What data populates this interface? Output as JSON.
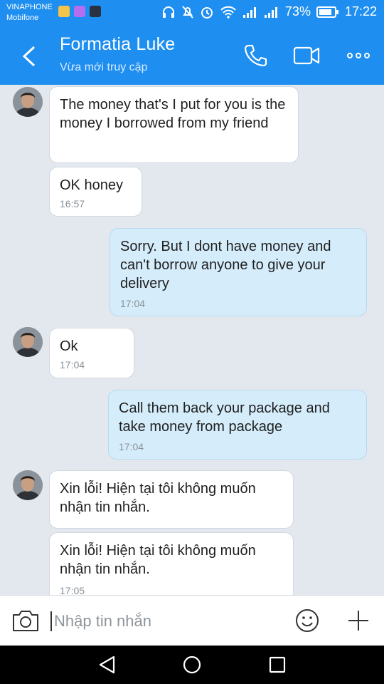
{
  "status_bar": {
    "carrier_1": "VINAPHONE",
    "carrier_2": "Mobifone",
    "battery_percent": "73%",
    "time": "17:22"
  },
  "header": {
    "contact_name": "Formatia Luke",
    "last_seen": "Vừa mới truy cập",
    "icons": [
      "back-arrow-icon",
      "phone-icon",
      "video-call-icon",
      "more-icon"
    ]
  },
  "messages": [
    {
      "direction": "in",
      "text": "The money that's I put for you is the money I borrowed from my friend",
      "time": ""
    },
    {
      "direction": "in",
      "text": "OK honey",
      "time": "16:57"
    },
    {
      "direction": "out",
      "text": "Sorry. But I dont have money and can't borrow anyone to give your delivery",
      "time": "17:04"
    },
    {
      "direction": "in",
      "text": "Ok",
      "time": "17:04"
    },
    {
      "direction": "out",
      "text": "Call them back your package and take money from package",
      "time": "17:04"
    },
    {
      "direction": "in",
      "text": "Xin lỗi! Hiện tại tôi không muốn nhận tin nhắn.",
      "time": ""
    },
    {
      "direction": "in",
      "text": "Xin lỗi! Hiện tại tôi không muốn nhận tin nhắn.",
      "time": "17:05"
    }
  ],
  "composer": {
    "placeholder": "Nhập tin nhắn",
    "icons": [
      "camera-icon",
      "emoji-icon",
      "plus-icon"
    ]
  },
  "colors": {
    "brand": "#1e8ff0",
    "outgoing_bubble": "#d5edfb",
    "incoming_bubble": "#ffffff",
    "chat_background": "#e3e8ee"
  }
}
